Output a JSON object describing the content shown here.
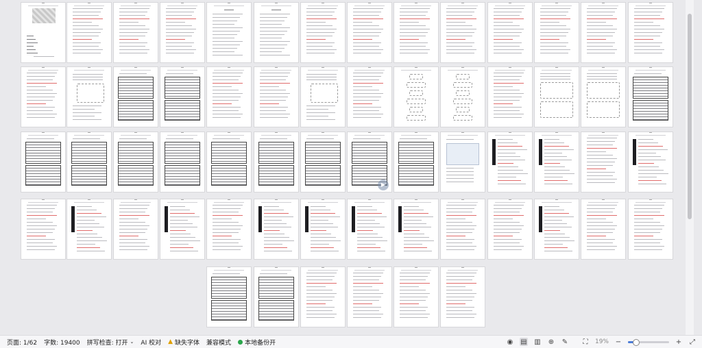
{
  "statusbar": {
    "page": "页面: 1/62",
    "word_count": "字数: 19400",
    "spellcheck": "拼写检查: 打开",
    "ai_proofread": "AI 校对",
    "missing_font": "缺失字体",
    "compat_mode": "兼容模式",
    "local_backup": "本地备份开",
    "zoom_value": "19%",
    "zoom_level": 0.19
  },
  "icons": {
    "eye": "eye-icon",
    "page_view": "page-view-icon",
    "book_view": "book-view-icon",
    "web_view": "web-view-icon",
    "pen": "pen-icon",
    "fit": "fit-page-icon",
    "zoom_out": "minus-icon",
    "zoom_in": "plus-icon",
    "fullscreen": "fullscreen-icon"
  },
  "colors": {
    "accent": "#4a7bd8",
    "backup_dot": "#2aa54b",
    "warning": "#e0a000"
  },
  "document": {
    "page_count": 62
  }
}
